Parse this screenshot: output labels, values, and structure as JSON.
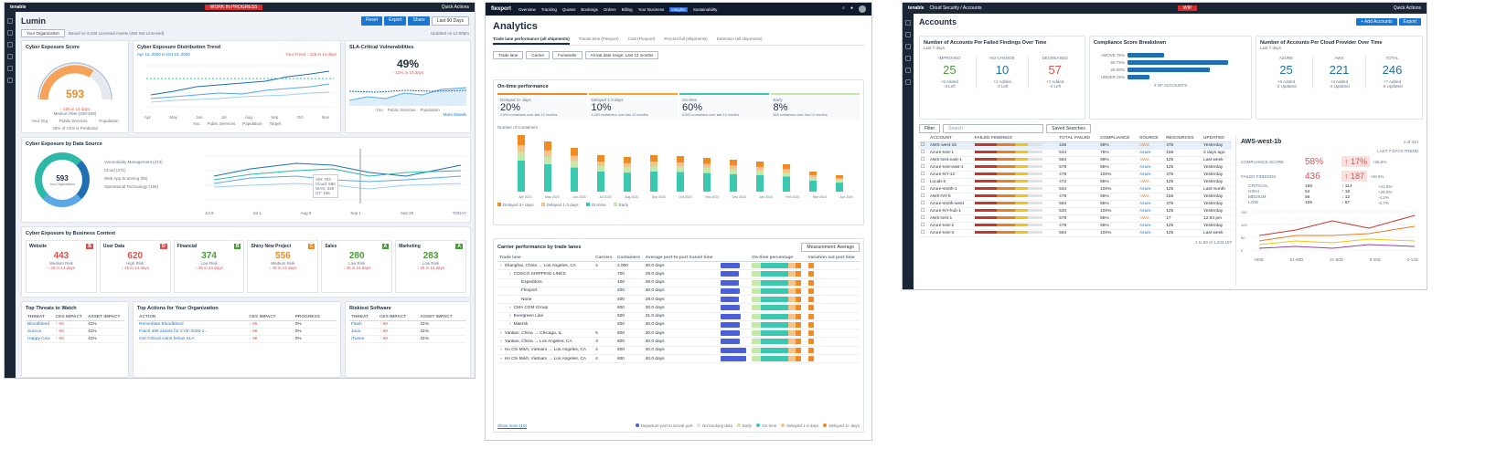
{
  "s1": {
    "brand": "tenable",
    "banner": "WORK IN PROGRESS",
    "quick": "Quick Actions",
    "title": "Lumin",
    "buttons": [
      "Reset",
      "Export",
      "Share"
    ],
    "period": "Last 90 Days",
    "org_select": "Your Organization",
    "basis": "Based on 5,435 Licensed Assets (455 Not Licensed)",
    "updated": "Updated on 12:00pm",
    "ces_title": "Cyber Exposure Score",
    "ces_value": "593",
    "ces_delta": "↑ 125 in 14 days",
    "ces_label": "Medium Risk (200-649)",
    "ces_target": "Target",
    "ces_legend": [
      "Your Org",
      "Public Services",
      "Population"
    ],
    "ces_note": "25% of CES is Predicted",
    "dist_title": "Cyber Exposure Distribution Trend",
    "dist_period": "Apr 14, 2020 to Oct 10, 2020",
    "dist_trend": "Your Trend ↑ 125 in 14 days",
    "dist_months": [
      "Apr",
      "May",
      "Jun",
      "Jul",
      "Aug",
      "Sep",
      "Oct",
      "Nov"
    ],
    "dist_legend": [
      "You",
      "Public Services",
      "Population",
      "Target"
    ],
    "sla_title": "SLA-Critical Vulnerabilities",
    "sla_value": "49%",
    "sla_delta": "↑ 12% in 14 days",
    "sla_legend": [
      "You",
      "Public Services",
      "Population"
    ],
    "sla_more": "More Details",
    "src_title": "Cyber Exposure by Data Source",
    "src_value": "593",
    "src_label": "Your Organization",
    "src_items": [
      "Vulnerability Management (273)",
      "Cloud (271)",
      "Web App Scanning (95)",
      "Operational Technology (156)"
    ],
    "src_xlabels": [
      "Jul 9",
      "Jul 1",
      "Aug 9",
      "Sep 1",
      "Sep 25",
      "TODAY"
    ],
    "src_tooltip": [
      "VM: 783",
      "Cloud: 580",
      "WAS: 336",
      "OT: 155"
    ],
    "biz_title": "Cyber Exposure by Business Context",
    "biz": [
      {
        "name": "Website",
        "value": "443",
        "risk": "Medium Risk",
        "grade": "B",
        "delta": "↑ 45 in 14 days",
        "color": "#d9534f"
      },
      {
        "name": "User Data",
        "value": "620",
        "risk": "High Risk",
        "grade": "D",
        "delta": "↑ 45 in 14 days",
        "color": "#d9534f"
      },
      {
        "name": "Financial",
        "value": "374",
        "risk": "Low Risk",
        "grade": "B",
        "delta": "↑ 45 in 14 days",
        "color": "#4b9b39"
      },
      {
        "name": "Shiny New Project",
        "value": "556",
        "risk": "Medium Risk",
        "grade": "C",
        "delta": "↑ 45 in 14 days",
        "color": "#f08a24"
      },
      {
        "name": "Sales",
        "value": "280",
        "risk": "Low Risk",
        "grade": "A",
        "delta": "↑ 45 in 14 days",
        "color": "#4b9b39"
      },
      {
        "name": "Marketing",
        "value": "283",
        "risk": "Low Risk",
        "grade": "A",
        "delta": "↑ 45 in 14 days",
        "color": "#4b9b39"
      }
    ],
    "threats_title": "Top Threats to Watch",
    "threats_cols": [
      "THREAT",
      "CES IMPACT",
      "ASSET IMPACT"
    ],
    "threats": [
      [
        "Bloodbleed",
        "↑ 98",
        "41%"
      ],
      [
        "Sunrun",
        "↑ 98",
        "41%"
      ],
      [
        "Happy Cow",
        "↑ 98",
        "41%"
      ]
    ],
    "actions_title": "Top Actions for Your Organization",
    "actions_cols": [
      "ACTION",
      "CES IMPACT",
      "PROGRESS"
    ],
    "actions": [
      [
        "Remediate Bloodbleed",
        "↓ 65",
        "0%"
      ],
      [
        "Patch 499 assets for CVE-2020-1...",
        "↓ 98",
        "0%"
      ],
      [
        "Get Critical vulns below SLA",
        "↓ 98",
        "0%"
      ]
    ],
    "sw_title": "Riskiest Software",
    "sw_cols": [
      "THREAT",
      "CES IMPACT",
      "ASSET IMPACT"
    ],
    "sw": [
      [
        "Flash",
        "↑ 98",
        "41%"
      ],
      [
        "Java",
        "↑ 98",
        "41%"
      ],
      [
        "iTunes",
        "↑ 98",
        "41%"
      ]
    ]
  },
  "s2": {
    "brand": "flexport",
    "nav": [
      "Overview",
      "Tracking",
      "Quotes",
      "Bookings",
      "Orders",
      "Billing",
      "Your Business",
      "Insights",
      "Sustainability"
    ],
    "title": "Analytics",
    "tabs": [
      "Trade lane performance (all shipments)",
      "Transit time (Flexport)",
      "Cost (Flexport)",
      "Percent full (shipments)",
      "Detention (all shipments)"
    ],
    "filters": [
      "Trade lane",
      "Carrier",
      "Forwarder",
      "Arrival date range: Last 12 months"
    ],
    "otp_title": "On-time performance",
    "otp": [
      {
        "label": "Delayed 3+ days",
        "value": "20%",
        "sub": "2,000 containers over last 12 months",
        "color": "#f08a24"
      },
      {
        "label": "Delayed 1-3 days",
        "value": "10%",
        "sub": "1,000 containers over last 12 months",
        "color": "#f5a623"
      },
      {
        "label": "On-time",
        "value": "60%",
        "sub": "6,000 containers over last 12 months",
        "color": "#3ac9b0"
      },
      {
        "label": "Early",
        "value": "8%",
        "sub": "800 containers over last 12 months",
        "color": "#c5e9a8"
      }
    ],
    "chart_ylabel": "Number of Containers",
    "chart_months": [
      "Apr 2023",
      "May 2023",
      "Jun 2023",
      "Jul 2023",
      "Aug 2023",
      "Sep 2023",
      "Oct 2023",
      "Nov 2023",
      "Dec 2023",
      "Jan 2024",
      "Feb 2024",
      "Mar 2024",
      "Apr 2024"
    ],
    "chart_legend": [
      "Delayed 3+ days",
      "Delayed 1-3 days",
      "On-time",
      "Early"
    ],
    "carrier_title": "Carrier performance by trade lanes",
    "measurement": "Measurement: Average",
    "carrier_cols": [
      "Trade lane",
      "Carriers",
      "Containers",
      "Average port-to-port transit time",
      "On-time percentage",
      "Variation out port time"
    ],
    "carrier_rows": [
      {
        "lane": "Shanghai, China → Los Angeles, CA",
        "carriers": "4",
        "containers": "2,000",
        "avg": "30.0 days",
        "indent": 0
      },
      {
        "lane": "COSCO SHIPPING LINES",
        "carriers": "",
        "containers": "700",
        "avg": "29.0 days",
        "indent": 1
      },
      {
        "lane": "Expeditors",
        "carriers": "",
        "containers": "100",
        "avg": "28.0 days",
        "indent": 2
      },
      {
        "lane": "Flexport",
        "carriers": "",
        "containers": "200",
        "avg": "30.0 days",
        "indent": 2
      },
      {
        "lane": "None",
        "carriers": "",
        "containers": "400",
        "avg": "29.0 days",
        "indent": 2
      },
      {
        "lane": "CMA CGM Group",
        "carriers": "",
        "containers": "600",
        "avg": "30.0 days",
        "indent": 1
      },
      {
        "lane": "Evergreen Line",
        "carriers": "",
        "containers": "500",
        "avg": "31.0 days",
        "indent": 1
      },
      {
        "lane": "Maersk",
        "carriers": "",
        "containers": "200",
        "avg": "30.0 days",
        "indent": 1
      },
      {
        "lane": "Yantian, China → Chicago, IL",
        "carriers": "5",
        "containers": "600",
        "avg": "30.0 days",
        "indent": 0
      },
      {
        "lane": "Yantian, China → Los Angeles, CA",
        "carriers": "3",
        "containers": "600",
        "avg": "30.0 days",
        "indent": 0
      },
      {
        "lane": "Ho Chi Minh, Vietnam → Los Angeles, CA",
        "carriers": "4",
        "containers": "600",
        "avg": "40.0 days",
        "indent": 0
      },
      {
        "lane": "Ho Chi Minh, Vietnam → Los Angeles, CA",
        "carriers": "4",
        "containers": "600",
        "avg": "40.0 days",
        "indent": 0
      }
    ],
    "show_more": "Show more (10)",
    "carrier_legend": [
      "Departure port to arrival port",
      "No tracking data",
      "Early",
      "On-time",
      "Delayed 1-3 days",
      "Delayed 3+ days"
    ]
  },
  "s3": {
    "brand": "tenable",
    "crumb": "Cloud Security  /  Accounts",
    "wip": "WIP",
    "quick": "Quick Actions",
    "title": "Accounts",
    "add": "+ Add Accounts",
    "export": "Export",
    "c1_title": "Number of Accounts Per Failed Findings Over Time",
    "c1_sub": "Last 7 days",
    "c1": [
      {
        "label": "IMPROVED",
        "value": "25",
        "notes": [
          "+5 Added",
          "-3 Left"
        ],
        "color": "#4b9b39"
      },
      {
        "label": "NO CHANGE",
        "value": "10",
        "notes": [
          "+2 Added",
          "-3 Left"
        ],
        "color": "#1f6fb2"
      },
      {
        "label": "DECREASED",
        "value": "57",
        "notes": [
          "+7 Added",
          "-2 Left"
        ],
        "color": "#d9534f"
      }
    ],
    "c2_title": "Compliance Score Breakdown",
    "c2_cats": [
      "ABOVE 75%",
      "50-75%",
      "25-50%",
      "UNDER 25%"
    ],
    "c2_xlabel": "# OF ACCOUNTS",
    "c3_title": "Number of Accounts Per Cloud Provider Over Time",
    "c3_sub": "Last 7 days",
    "c3": [
      {
        "label": "AZURE",
        "value": "25",
        "notes": [
          "+5 Added",
          "-2 Updated"
        ]
      },
      {
        "label": "AWS",
        "value": "221",
        "notes": [
          "+2 Added",
          "-3 Updated"
        ]
      },
      {
        "label": "TOTAL",
        "value": "246",
        "notes": [
          "+7 Added",
          "-5 Updated"
        ]
      }
    ],
    "filter": "Filter",
    "search": "Search",
    "saved": "Saved Searches",
    "cols": [
      "ACCOUNT",
      "FAILED FINDINGS",
      "TOTAL FAILED",
      "COMPLIANCE",
      "SOURCE",
      "RESOURCES",
      "UPDATED"
    ],
    "rows": [
      [
        "AWS-west-1b",
        "436",
        "58%",
        "AWS",
        "476",
        "Yesterday"
      ],
      [
        "Azure-test-1",
        "544",
        "75%",
        "Azure",
        "156",
        "2 days ago"
      ],
      [
        "AWS-test-east-1",
        "584",
        "98%",
        "AWS",
        "125",
        "Last week"
      ],
      [
        "Azure-test-east-1",
        "579",
        "85%",
        "Azure",
        "125",
        "Yesterday"
      ],
      [
        "Azure-NY-12",
        "479",
        "100%",
        "Azure",
        "476",
        "Yesterday"
      ],
      [
        "Locab-5",
        "472",
        "85%",
        "AWS",
        "125",
        "Yesterday"
      ],
      [
        "Azure-smith-1",
        "544",
        "100%",
        "Azure",
        "125",
        "Last month"
      ],
      [
        "AWS-NY-5",
        "479",
        "95%",
        "AWS",
        "156",
        "Yesterday"
      ],
      [
        "Azure-smith-west",
        "584",
        "85%",
        "Azure",
        "476",
        "Yesterday"
      ],
      [
        "Azure-NY-hub-1",
        "534",
        "100%",
        "Azure",
        "125",
        "Yesterday"
      ],
      [
        "AWS-test-1",
        "579",
        "85%",
        "AWS",
        "17",
        "12:54 pm"
      ],
      [
        "Azure-test-2",
        "479",
        "95%",
        "Azure",
        "125",
        "Yesterday"
      ],
      [
        "Azure-test-3",
        "584",
        "100%",
        "Azure",
        "125",
        "Last week"
      ]
    ],
    "pager": "1 to 50 of 1,234,197",
    "detail_title": "AWS-west-1b",
    "detail_page": "1 of 314",
    "detail_trend": "LAST 7 DAYS TREND",
    "compliance_label": "COMPLIANCE SCORE",
    "compliance_value": "58%",
    "compliance_delta": "↑ 17%",
    "compliance_sub": "+26.5%",
    "failed_label": "FAILED FINDINGS",
    "failed_value": "436",
    "failed_delta": "↑ 187",
    "failed_sub": "+26.5%",
    "sev": [
      [
        "CRITICAL",
        "158",
        "↑ 114",
        "+41.5%"
      ],
      [
        "HIGH",
        "54",
        "↑ 18",
        "+26.5%"
      ],
      [
        "MEDIUM",
        "56",
        "↓ 12",
        "-4.2%"
      ],
      [
        "LOW",
        "105",
        "↓ 67",
        "-6.7%"
      ]
    ],
    "chart_y": [
      "150",
      "100",
      "50",
      "0"
    ],
    "chart_x": [
      "<60D",
      "61-90D",
      "31-60D",
      "8-30D",
      "0-14D"
    ]
  }
}
